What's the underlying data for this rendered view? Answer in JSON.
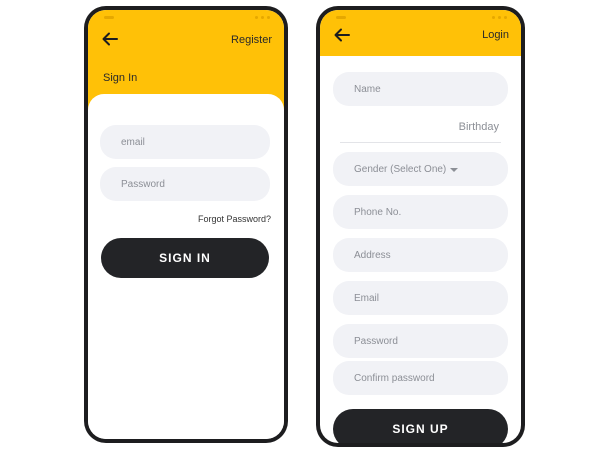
{
  "signin_screen": {
    "header_link": "Register",
    "title": "Sign In",
    "email_placeholder": "email",
    "password_placeholder": "Password",
    "forgot_link": "Forgot Password?",
    "submit_label": "SIGN IN"
  },
  "signup_screen": {
    "header_link": "Login",
    "name_placeholder": "Name",
    "birthday_label": "Birthday",
    "gender_placeholder": "Gender (Select One)",
    "phone_placeholder": "Phone No.",
    "address_placeholder": "Address",
    "email_placeholder": "Email",
    "password_placeholder": "Password",
    "confirm_password_placeholder": "Confirm password",
    "submit_label": "SIGN UP"
  },
  "colors": {
    "header": "#ffc107",
    "button": "#232427",
    "field": "#f1f2f6",
    "frame": "#1d1d1f"
  },
  "icons": {
    "back": "arrow-left-icon",
    "dropdown": "caret-down-icon"
  }
}
